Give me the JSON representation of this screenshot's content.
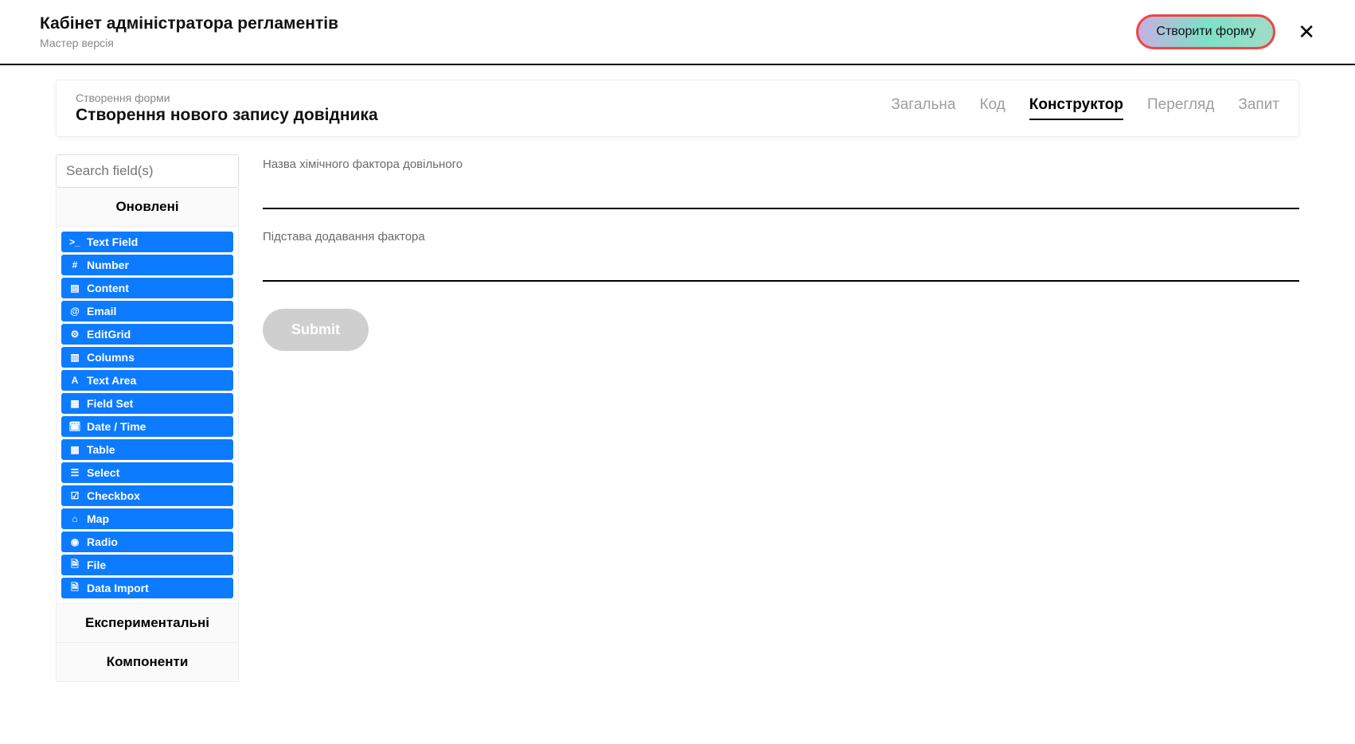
{
  "header": {
    "title": "Кабінет адміністратора регламентів",
    "subtitle": "Мастер версія",
    "create_button": "Створити форму"
  },
  "subheader": {
    "breadcrumb": "Створення форми",
    "page_title": "Створення нового запису довідника"
  },
  "tabs": {
    "general": "Загальна",
    "code": "Код",
    "constructor": "Конструктор",
    "preview": "Перегляд",
    "request": "Запит",
    "active": "constructor"
  },
  "sidebar": {
    "search_placeholder": "Search field(s)",
    "groups": {
      "updated": "Оновлені",
      "experimental": "Експериментальні",
      "components": "Компоненти"
    },
    "items": [
      {
        "icon": "terminal",
        "label": "Text Field"
      },
      {
        "icon": "hash",
        "label": "Number"
      },
      {
        "icon": "doc",
        "label": "Content"
      },
      {
        "icon": "at",
        "label": "Email"
      },
      {
        "icon": "gear",
        "label": "EditGrid"
      },
      {
        "icon": "columns",
        "label": "Columns"
      },
      {
        "icon": "font",
        "label": "Text Area"
      },
      {
        "icon": "grid",
        "label": "Field Set"
      },
      {
        "icon": "calendar",
        "label": "Date / Time"
      },
      {
        "icon": "table",
        "label": "Table"
      },
      {
        "icon": "list",
        "label": "Select"
      },
      {
        "icon": "check",
        "label": "Checkbox"
      },
      {
        "icon": "home",
        "label": "Map"
      },
      {
        "icon": "radio",
        "label": "Radio"
      },
      {
        "icon": "file",
        "label": "File"
      },
      {
        "icon": "file",
        "label": "Data Import"
      }
    ]
  },
  "canvas": {
    "field1_label": "Назва хімічного фактора довільного",
    "field2_label": "Підстава додавання фактора",
    "submit_label": "Submit"
  }
}
